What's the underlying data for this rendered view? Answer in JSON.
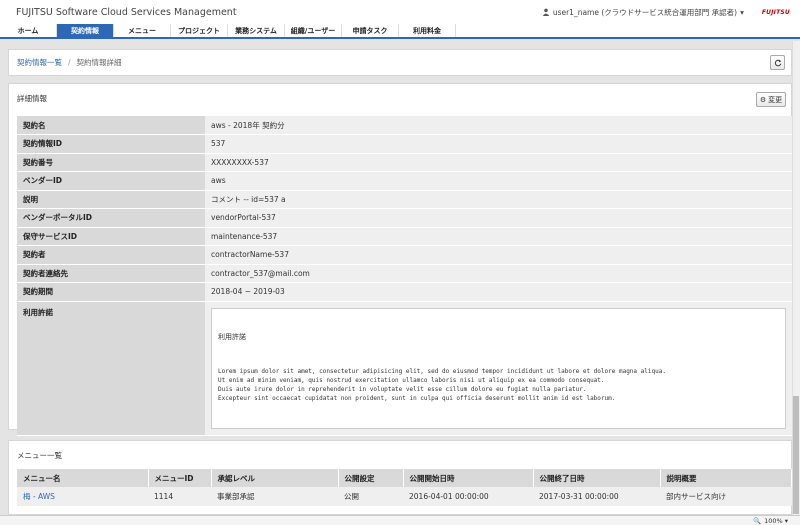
{
  "header": {
    "app_title": "FUJITSU Software Cloud Services Management",
    "user": "user1_name (クラウドサービス統合運用部門 承認者)",
    "brand": "FUJITSU"
  },
  "nav": [
    {
      "label": "ホーム"
    },
    {
      "label": "契約情報"
    },
    {
      "label": "メニュー"
    },
    {
      "label": "プロジェクト"
    },
    {
      "label": "業務システム"
    },
    {
      "label": "組織/ユーザー"
    },
    {
      "label": "申請タスク"
    },
    {
      "label": "利用料金"
    }
  ],
  "breadcrumb": {
    "parent": "契約情報一覧",
    "separator": "/",
    "current": "契約情報詳細"
  },
  "details": {
    "title": "詳細情報",
    "edit_label": "変更",
    "rows": [
      {
        "key": "契約名",
        "value": "aws - 2018年 契約分"
      },
      {
        "key": "契約情報ID",
        "value": "537"
      },
      {
        "key": "契約番号",
        "value": "XXXXXXXX-537"
      },
      {
        "key": "ベンダーID",
        "value": "aws"
      },
      {
        "key": "説明",
        "value": "コメント -- id=537 a"
      },
      {
        "key": "ベンダーポータルID",
        "value": "vendorPortal-537"
      },
      {
        "key": "保守サービスID",
        "value": "maintenance-537"
      },
      {
        "key": "契約者",
        "value": "contractorName-537"
      },
      {
        "key": "契約者連絡先",
        "value": "contractor_537@mail.com"
      },
      {
        "key": "契約期間",
        "value": "2018-04 ~ 2019-03"
      }
    ],
    "license": {
      "key": "利用許諾",
      "title": "利用許諾",
      "body": "Lorem ipsum dolor sit amet, consectetur adipisicing elit, sed do eiusmod tempor incididunt ut labore et dolore magna aliqua.\nUt enim ad minim veniam, quis nostrud exercitation ullamco laboris nisi ut aliquip ex ea commodo consequat.\nDuis aute irure dolor in reprehenderit in voluptate velit esse cillum dolore eu fugiat nulla pariatur.\nExcepteur sint occaecat cupidatat non proident, sunt in culpa qui officia deserunt mollit anim id est laborum."
    }
  },
  "menus": {
    "title": "メニュー一覧",
    "columns": [
      "メニュー名",
      "メニューID",
      "承認レベル",
      "公開設定",
      "公開開始日時",
      "公開終了日時",
      "説明概要"
    ],
    "rows": [
      [
        "梅 - AWS",
        "1114",
        "事業部承認",
        "公開",
        "2016-04-01 00:00:00",
        "2017-03-31 00:00:00",
        "部内サービス向け"
      ]
    ]
  },
  "status": {
    "zoom": "100%"
  }
}
